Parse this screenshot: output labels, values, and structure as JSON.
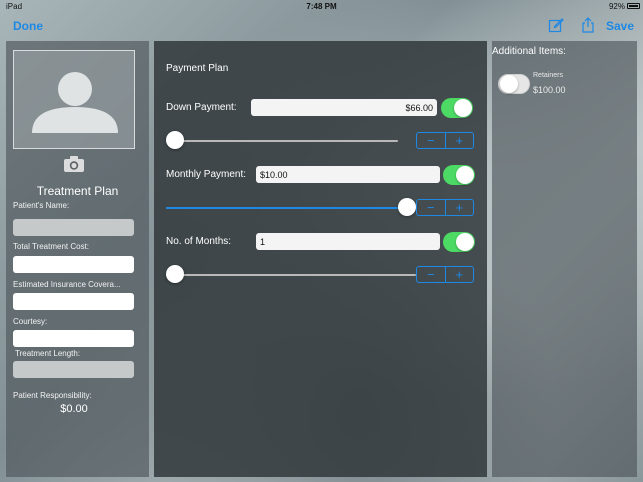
{
  "status_bar": {
    "device": "iPad",
    "time": "7:48 PM",
    "battery": "92%"
  },
  "nav": {
    "done_label": "Done",
    "save_label": "Save",
    "accent_color": "#1e88e5"
  },
  "treatment_plan": {
    "title": "Treatment Plan",
    "fields": [
      {
        "label": "Patient's Name:",
        "value": ""
      },
      {
        "label": "Total Treatment Cost:",
        "value": ""
      },
      {
        "label": "Estimated Insurance Covera...",
        "value": ""
      },
      {
        "label": "Courtesy:",
        "value": ""
      },
      {
        "label": "Treatment Length:",
        "value": ""
      }
    ],
    "responsibility_label": "Patient Responsibility:",
    "responsibility_value": "$0.00"
  },
  "payment_plan": {
    "title": "Payment Plan",
    "down_payment": {
      "label": "Down Payment:",
      "value": "$66.00",
      "toggle_on": true,
      "slider_fraction": 0.0
    },
    "monthly_payment": {
      "label": "Monthly Payment:",
      "value": "$10.00",
      "toggle_on": true,
      "slider_fraction": 1.0
    },
    "months": {
      "label": "No. of Months:",
      "value": "1",
      "toggle_on": true,
      "slider_fraction": 0.0
    },
    "stepper_minus": "−",
    "stepper_plus": "+"
  },
  "additional_items": {
    "title": "Additional Items:",
    "items": [
      {
        "name": "Retainers",
        "price": "$100.00",
        "toggle_on": false
      }
    ]
  }
}
